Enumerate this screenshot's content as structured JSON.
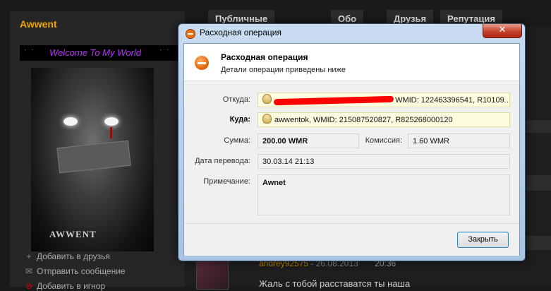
{
  "profile": {
    "username": "Awwent",
    "welcome_text": "Welcome To My World",
    "welcome_dots_left": "·  ·",
    "welcome_dots_right": "·  ·",
    "avatar_signature": "AWWENT",
    "actions": [
      {
        "icon": "plus-icon",
        "label": "Добавить в друзья"
      },
      {
        "icon": "envelope-icon",
        "label": "Отправить сообщение"
      },
      {
        "icon": "block-icon",
        "label": "Добавить в игнор"
      }
    ]
  },
  "tabs": [
    {
      "label": "Публичные сообщения"
    },
    {
      "label": "Обо мне"
    },
    {
      "label": "Друзья"
    },
    {
      "label": "Репутация"
    }
  ],
  "comment": {
    "author": "andrey92575",
    "separator": " - ",
    "date": "26.08.2013",
    "time": "20:36",
    "text": "Жаль с тобой расставатся ты наша"
  },
  "dialog": {
    "title": "Расходная операция",
    "close_label": "✕",
    "header_title": "Расходная операция",
    "header_subtitle": "Детали операции приведены ниже",
    "fields": {
      "from_label": "Откуда:",
      "from_value": "WMID: 122463396541, R10109...",
      "to_label": "Куда:",
      "to_value": "awwentok, WMID: 215087520827, R825268000120",
      "amount_label": "Сумма:",
      "amount_value": "200.00 WMR",
      "fee_label": "Комиссия:",
      "fee_value": "1.60 WMR",
      "date_label": "Дата перевода:",
      "date_value": "30.03.14 21:13",
      "note_label": "Примечание:",
      "note_value": "Awnet"
    },
    "ok_label": "Закрыть"
  }
}
